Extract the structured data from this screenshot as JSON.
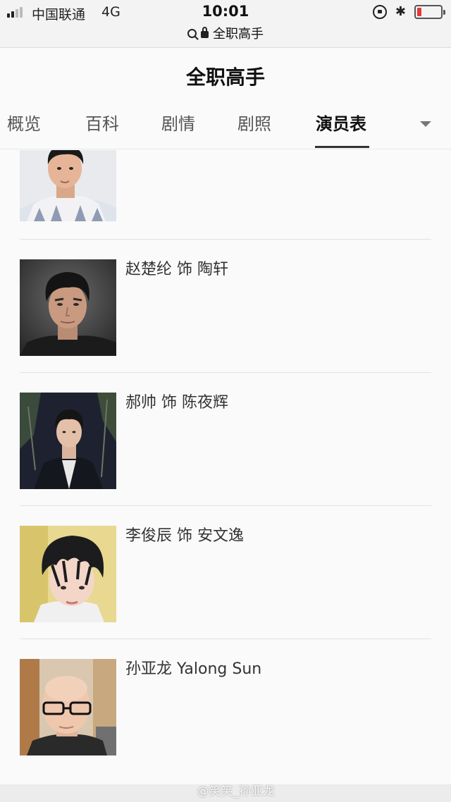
{
  "status_bar": {
    "carrier": "中国联通",
    "network": "4G",
    "time": "10:01",
    "url": "全职高手",
    "icons": [
      "signal-icon",
      "orientation-lock-icon",
      "bluetooth-icon",
      "battery-icon"
    ],
    "battery_level": 0.15,
    "battery_color": "#e53935"
  },
  "header": {
    "title": "全职高手"
  },
  "tabs": [
    {
      "label": "概览"
    },
    {
      "label": "百科"
    },
    {
      "label": "剧情"
    },
    {
      "label": "剧照"
    },
    {
      "label": "演员表",
      "active": true
    }
  ],
  "cast": [
    {
      "name": ""
    },
    {
      "name": "赵楚纶 饰 陶轩"
    },
    {
      "name": "郝帅 饰 陈夜辉"
    },
    {
      "name": "李俊辰 饰 安文逸"
    },
    {
      "name": "孙亚龙 Yalong Sun"
    }
  ],
  "watermark": "@笑笑_孙亚龙"
}
